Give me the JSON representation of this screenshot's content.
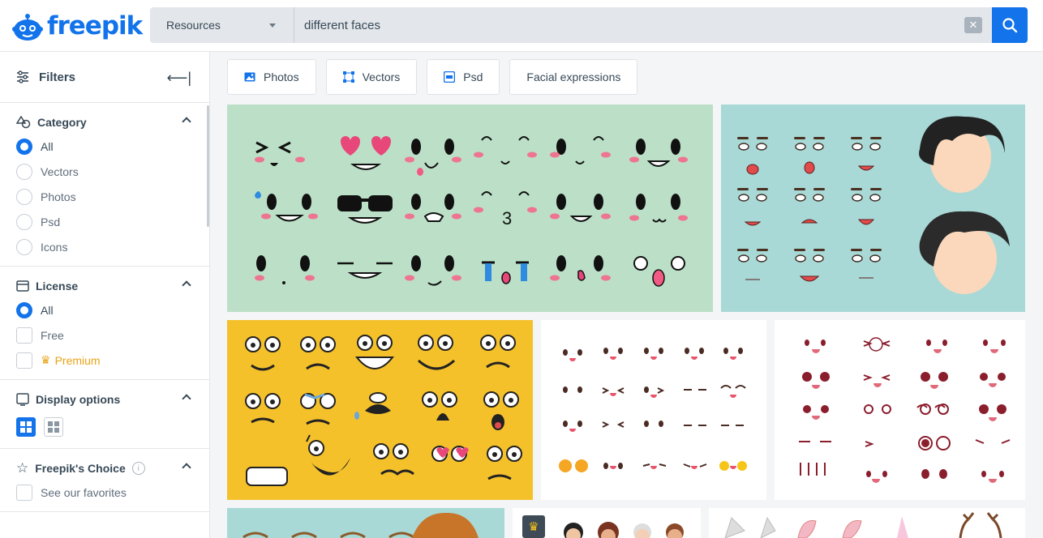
{
  "brand": {
    "name": "freepik",
    "color": "#1273eb"
  },
  "search": {
    "resource_type": "Resources",
    "query": "different faces",
    "clear_icon": "close-icon",
    "submit_icon": "search-icon"
  },
  "sidebar": {
    "filters_label": "Filters",
    "sections": {
      "category": {
        "title": "Category",
        "options": [
          "All",
          "Vectors",
          "Photos",
          "Psd",
          "Icons"
        ],
        "selected": "All"
      },
      "license": {
        "title": "License",
        "options": [
          "All",
          "Free",
          "Premium"
        ],
        "selected": "All"
      },
      "display": {
        "title": "Display options",
        "selected": "large-grid"
      },
      "choice": {
        "title": "Freepik's Choice",
        "option": "See our favorites"
      }
    }
  },
  "chips": [
    {
      "label": "Photos",
      "icon": "photo-icon"
    },
    {
      "label": "Vectors",
      "icon": "vector-icon"
    },
    {
      "label": "Psd",
      "icon": "psd-icon"
    },
    {
      "label": "Facial expressions",
      "icon": ""
    }
  ],
  "colors": {
    "accent": "#1273eb",
    "premium": "#e8a317",
    "tile_green": "#bce0c7",
    "tile_teal": "#a8d9d6",
    "tile_yellow": "#f5c12b",
    "tile_white": "#ffffff"
  }
}
